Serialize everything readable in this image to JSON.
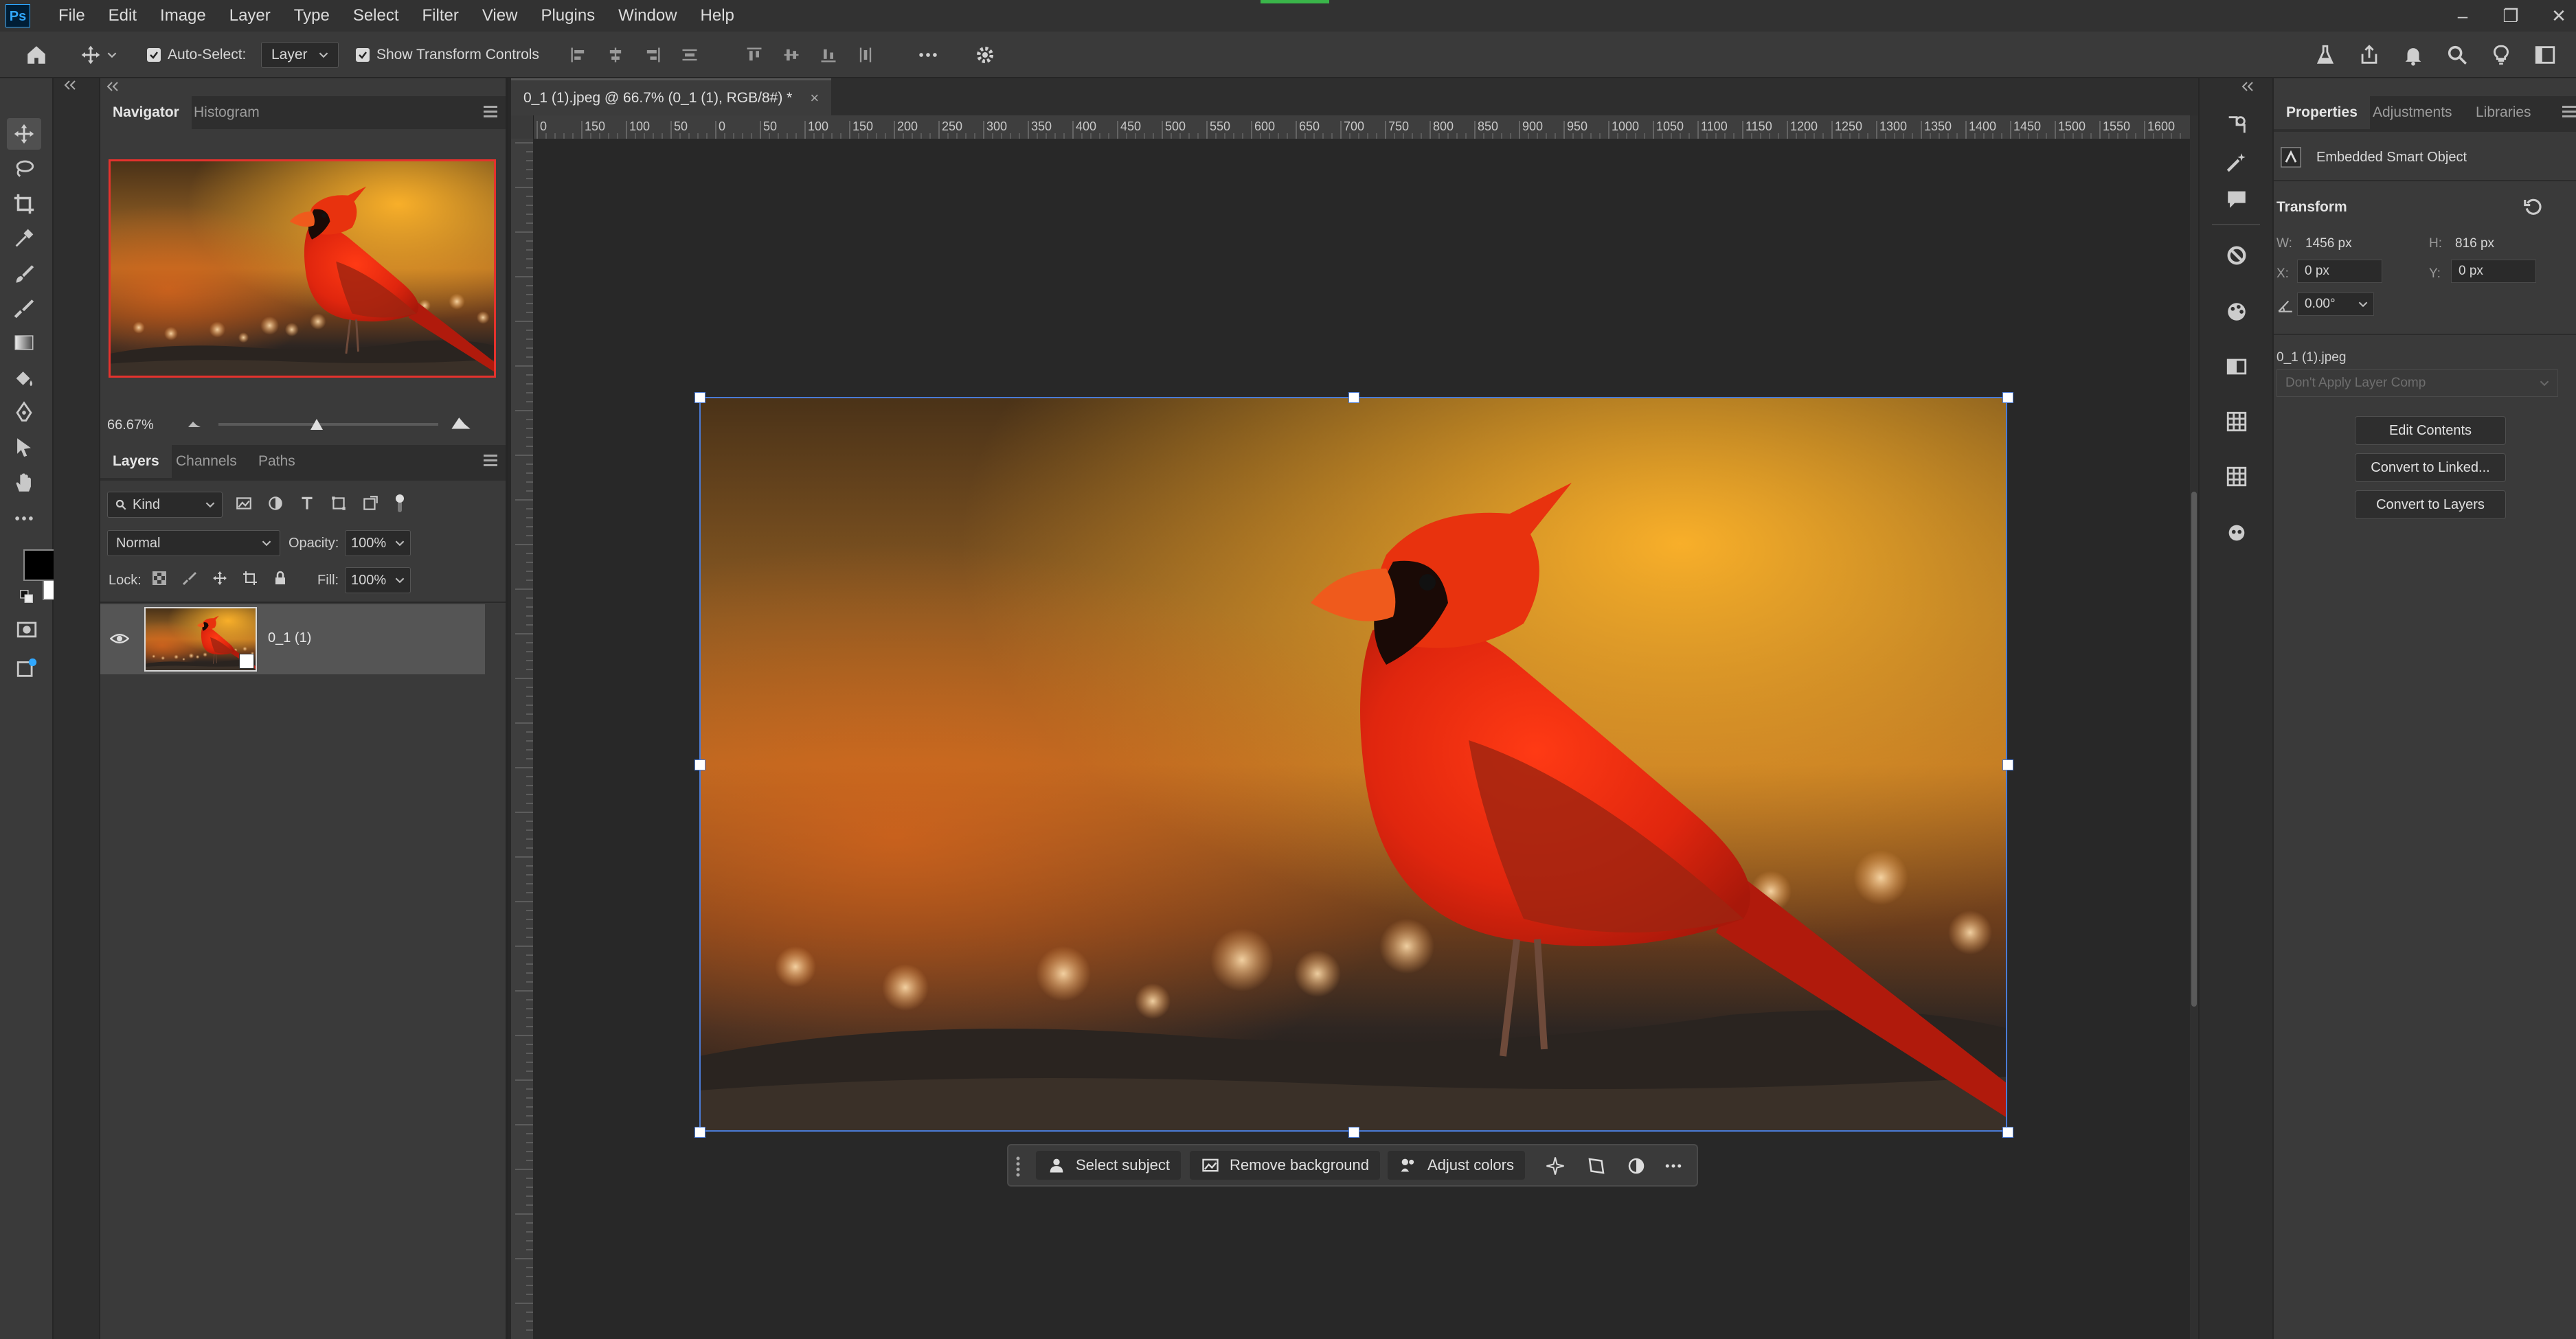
{
  "app": {
    "logo": "Ps"
  },
  "menu": [
    "File",
    "Edit",
    "Image",
    "Layer",
    "Type",
    "Select",
    "Filter",
    "View",
    "Plugins",
    "Window",
    "Help"
  ],
  "options": {
    "auto_select_label": "Auto-Select:",
    "auto_select_value": "Layer",
    "show_transform_label": "Show Transform Controls"
  },
  "navigator": {
    "tabs": [
      "Navigator",
      "Histogram"
    ],
    "zoom": "66.67%"
  },
  "layers_panel": {
    "tabs": [
      "Layers",
      "Channels",
      "Paths"
    ],
    "filter_kind": "Kind",
    "blend_mode": "Normal",
    "opacity_label": "Opacity:",
    "opacity_value": "100%",
    "lock_label": "Lock:",
    "fill_label": "Fill:",
    "fill_value": "100%",
    "layers": [
      {
        "name": "0_1 (1)",
        "visible": true
      }
    ]
  },
  "document": {
    "tab_title": "0_1 (1).jpeg @ 66.7% (0_1 (1), RGB/8#) *",
    "close": "×",
    "ruler_ticks": [
      "0",
      "150",
      "100",
      "50",
      "0",
      "50",
      "100",
      "150",
      "200",
      "250",
      "300",
      "350",
      "400",
      "450",
      "500",
      "550",
      "600",
      "650",
      "700",
      "750",
      "800",
      "850",
      "900",
      "950",
      "1000",
      "1050",
      "1100",
      "1150",
      "1200",
      "1250",
      "1300",
      "1350",
      "1400",
      "1450",
      "1500",
      "1550",
      "1600"
    ]
  },
  "taskbar": {
    "select_subject": "Select subject",
    "remove_background": "Remove background",
    "adjust_colors": "Adjust colors"
  },
  "properties": {
    "tabs": [
      "Properties",
      "Adjustments",
      "Libraries"
    ],
    "object_type": "Embedded Smart Object",
    "transform_title": "Transform",
    "w_label": "W:",
    "w_value": "1456 px",
    "h_label": "H:",
    "h_value": "816 px",
    "x_label": "X:",
    "x_value": "0 px",
    "y_label": "Y:",
    "y_value": "0 px",
    "angle_value": "0.00°",
    "filename": "0_1 (1).jpeg",
    "layer_comp": "Don't Apply Layer Comp",
    "edit_contents": "Edit Contents",
    "convert_linked": "Convert to Linked...",
    "convert_layers": "Convert to Layers"
  },
  "colors": {
    "accent": "#31a8ff",
    "panel": "#3a3a3a",
    "canvas": "#282828",
    "selection": "#4a7bd6"
  }
}
